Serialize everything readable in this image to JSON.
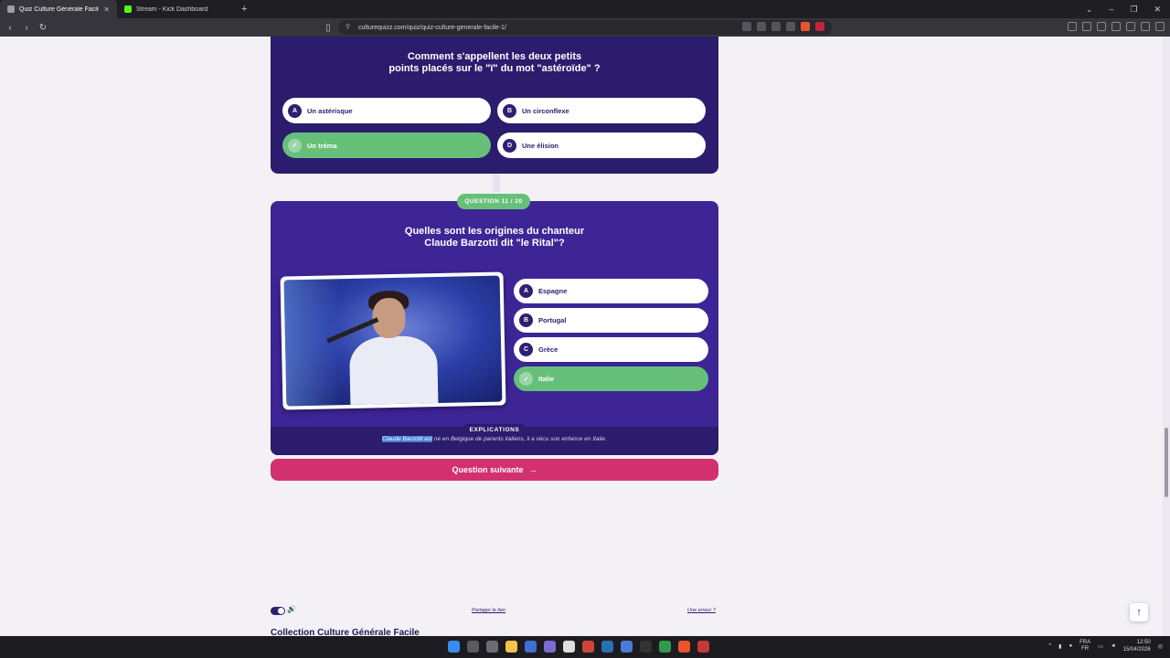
{
  "browser": {
    "tabs": [
      {
        "title": "Quiz Culture Générale Facile",
        "active": true,
        "favicon_color": "#9aa0a6"
      },
      {
        "title": "Stream - Kick Dashboard",
        "active": false,
        "favicon_color": "#53fc18"
      }
    ],
    "new_tab": "+",
    "url": "culturequizz.com/quiz/quiz-culture-generale-facile-1/"
  },
  "question_prev": {
    "title_line1": "Comment s'appellent les deux petits",
    "title_line2": "points placés sur le \"ï\" du mot \"astéroïde\" ?",
    "options": [
      {
        "letter": "A",
        "label": "Un astérisque",
        "correct": false
      },
      {
        "letter": "B",
        "label": "Un circonflexe",
        "correct": false
      },
      {
        "letter": "✓",
        "label": "Un tréma",
        "correct": true
      },
      {
        "letter": "D",
        "label": "Une élision",
        "correct": false
      }
    ]
  },
  "question": {
    "badge": "QUESTION 11 / 20",
    "title_line1": "Quelles sont les origines du chanteur",
    "title_line2": "Claude Barzotti dit \"le Rital\"?",
    "options": [
      {
        "letter": "A",
        "label": "Espagne",
        "correct": false
      },
      {
        "letter": "B",
        "label": "Portugal",
        "correct": false
      },
      {
        "letter": "C",
        "label": "Grèce",
        "correct": false
      },
      {
        "letter": "✓",
        "label": "Italie",
        "correct": true
      }
    ],
    "explications_title": "EXPLICATIONS",
    "explication_highlight": "Claude Barzotti est",
    "explication_rest": " né en Belgique de parents italiens, il a vécu son enfance en Italie."
  },
  "next_button": {
    "label": "Question suivante",
    "arrow": "→"
  },
  "footer": {
    "share": "Partager le lien",
    "error": "Une erreur ?",
    "collection": "Collection Culture Générale Facile",
    "back_to_top": "↑"
  },
  "taskbar": {
    "lang_line1": "FRA",
    "lang_line2": "FR",
    "time": "12:50",
    "date": "15/04/2026"
  },
  "colors": {
    "card_dark": "#2b1c6d",
    "card_active": "#3d2596",
    "correct": "#66c07a",
    "next_button": "#d2306f"
  }
}
